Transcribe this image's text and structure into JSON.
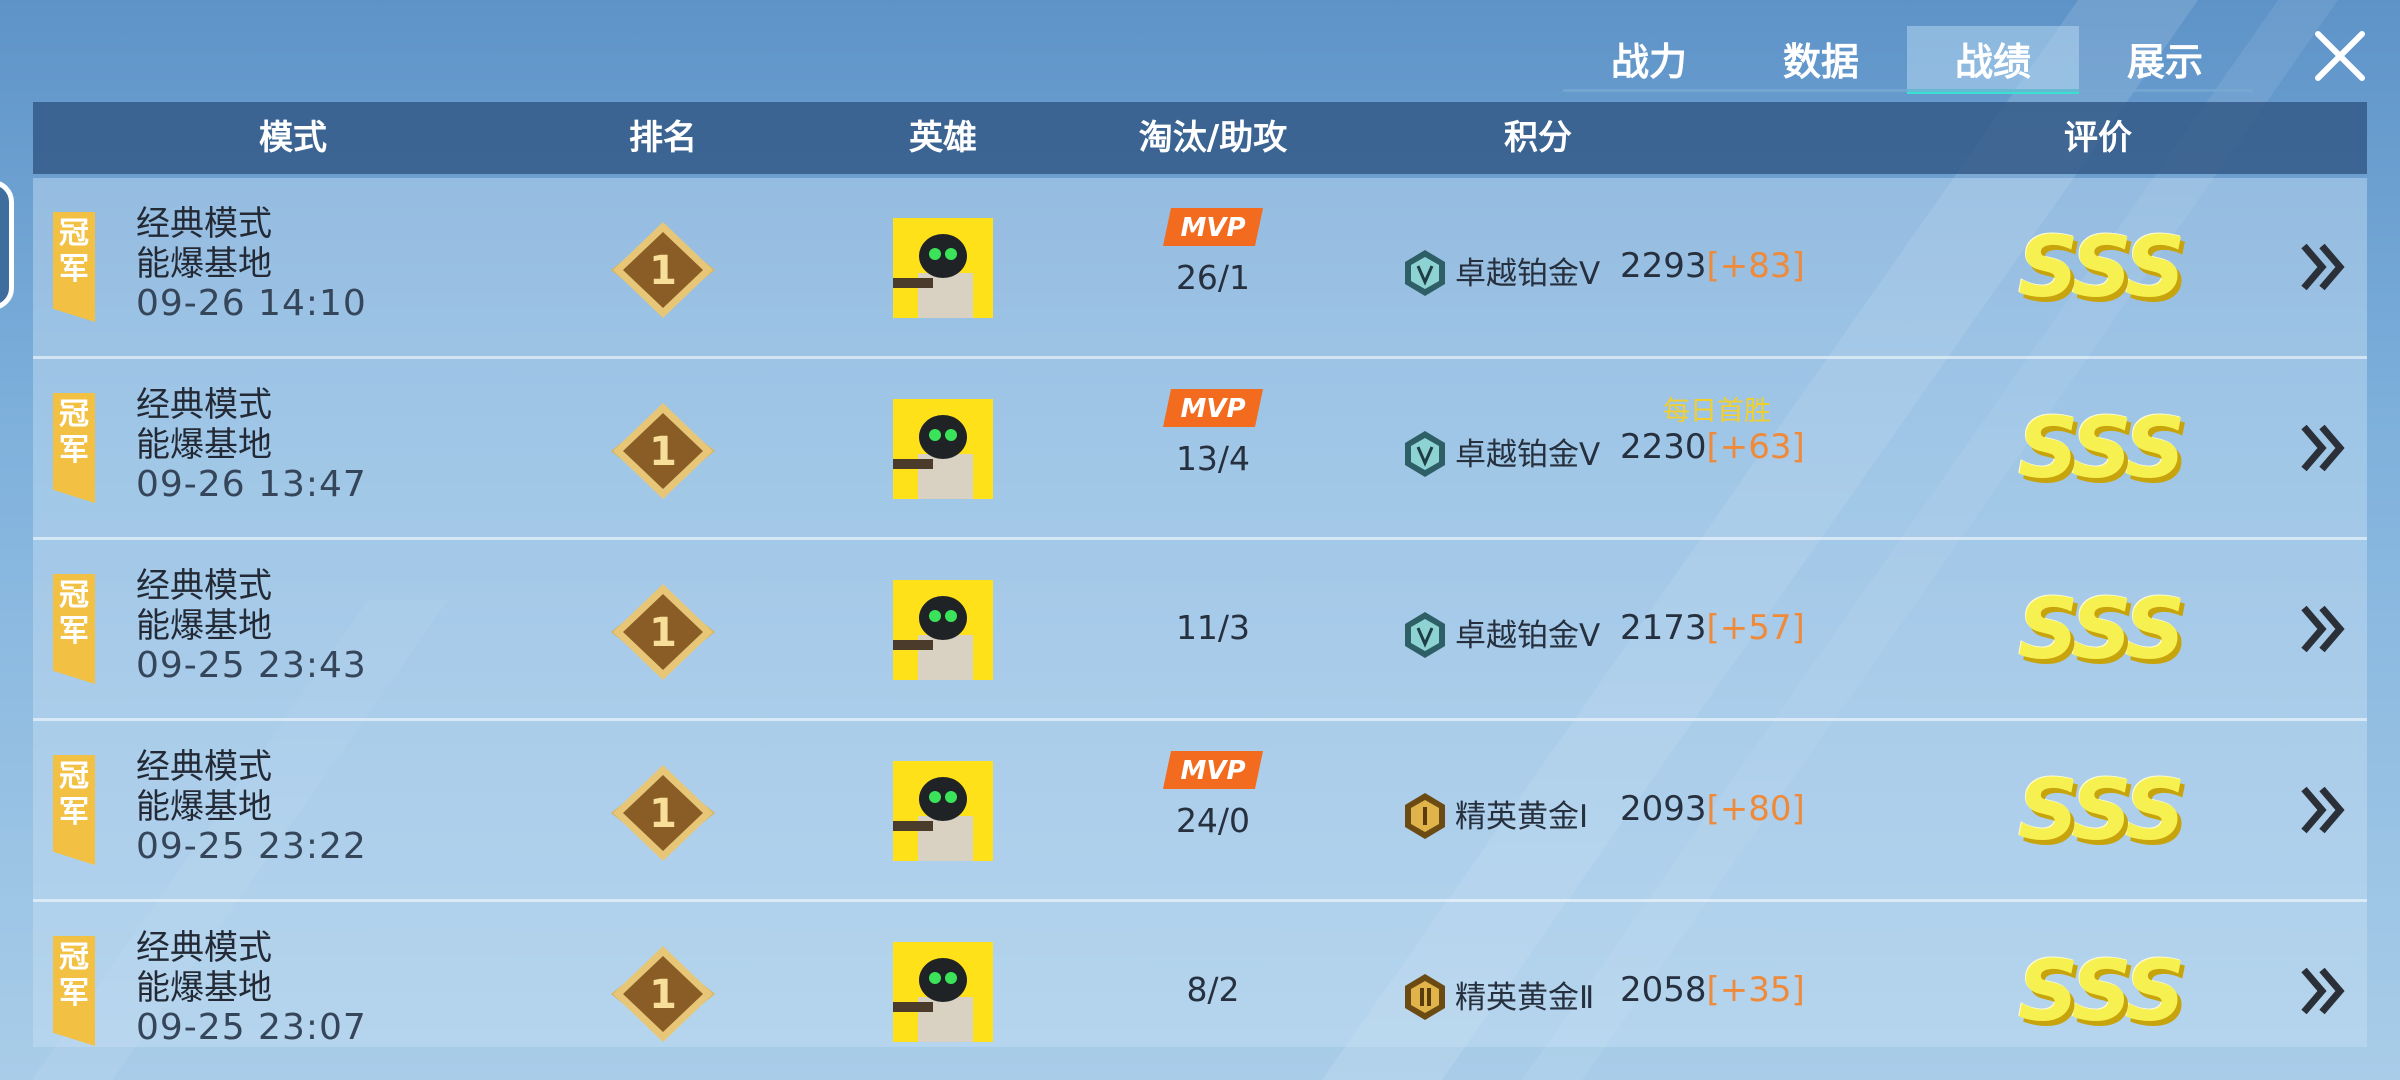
{
  "tabs": [
    {
      "label": "战力",
      "active": false
    },
    {
      "label": "数据",
      "active": false
    },
    {
      "label": "战绩",
      "active": true
    },
    {
      "label": "展示",
      "active": false
    }
  ],
  "header": {
    "mode": "模式",
    "rank": "排名",
    "hero": "英雄",
    "kills_assists": "淘汰/助攻",
    "points": "积分",
    "rating": "评价"
  },
  "rows": [
    {
      "badge": "冠军",
      "mode": "经典模式",
      "map": "能爆基地",
      "date": "09-26 14:10",
      "rank": "1",
      "mvp": "MVP",
      "kd": "26/1",
      "bonus": "",
      "tier": "卓越铂金Ⅴ",
      "score": "2293",
      "delta": "[+83]",
      "grade": "SSS"
    },
    {
      "badge": "冠军",
      "mode": "经典模式",
      "map": "能爆基地",
      "date": "09-26 13:47",
      "rank": "1",
      "mvp": "MVP",
      "kd": "13/4",
      "bonus": "每日首胜",
      "tier": "卓越铂金Ⅴ",
      "score": "2230",
      "delta": "[+63]",
      "grade": "SSS"
    },
    {
      "badge": "冠军",
      "mode": "经典模式",
      "map": "能爆基地",
      "date": "09-25 23:43",
      "rank": "1",
      "mvp": "",
      "kd": "11/3",
      "bonus": "",
      "tier": "卓越铂金Ⅴ",
      "score": "2173",
      "delta": "[+57]",
      "grade": "SSS"
    },
    {
      "badge": "冠军",
      "mode": "经典模式",
      "map": "能爆基地",
      "date": "09-25 23:22",
      "rank": "1",
      "mvp": "MVP",
      "kd": "24/0",
      "bonus": "",
      "tier": "精英黄金Ⅰ",
      "score": "2093",
      "delta": "[+80]",
      "grade": "SSS"
    },
    {
      "badge": "冠军",
      "mode": "经典模式",
      "map": "能爆基地",
      "date": "09-25 23:07",
      "rank": "1",
      "mvp": "",
      "kd": "8/2",
      "bonus": "",
      "tier": "精英黄金Ⅱ",
      "score": "2058",
      "delta": "[+35]",
      "grade": "SSS"
    }
  ],
  "icons": {
    "close": "close-icon",
    "rank_medal": "rank-medal-icon",
    "hero_avatar": "hero-avatar-icon",
    "tier_platinum": "platinum-tier-icon",
    "tier_gold": "gold-tier-icon",
    "details": "double-chevron-right-icon"
  },
  "colors": {
    "active_tab_underline": "#3be0d3",
    "delta": "#ef8a3a",
    "bonus": "#f3cf2c",
    "grade": "#f6f050",
    "mvp": "#f26b1f",
    "crown_badge": "#f2c043"
  }
}
